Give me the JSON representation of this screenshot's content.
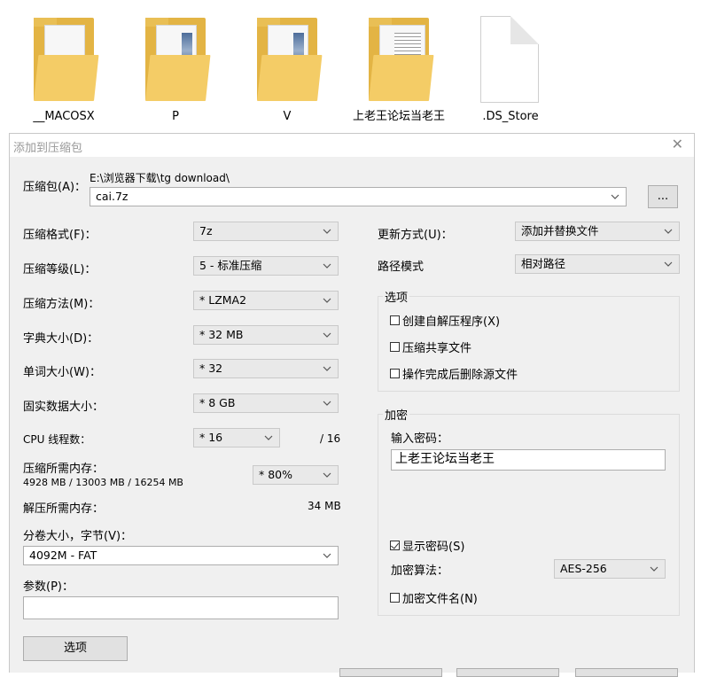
{
  "desktop": {
    "files": [
      {
        "name": "__MACOSX",
        "icon": "folder-icon"
      },
      {
        "name": "P",
        "icon": "folder-icon"
      },
      {
        "name": "V",
        "icon": "folder-icon"
      },
      {
        "name": "上老王论坛当老王",
        "icon": "folder-icon"
      },
      {
        "name": ".DS_Store",
        "icon": "file-icon"
      }
    ]
  },
  "dialog": {
    "title": "添加到压缩包",
    "close": "✕",
    "archive": {
      "label": "压缩包(A)：",
      "path": "E:\\浏览器下载\\tg download\\",
      "value": "cai.7z",
      "browse": "..."
    },
    "left": {
      "format": {
        "label": "压缩格式(F)：",
        "value": "7z"
      },
      "level": {
        "label": "压缩等级(L)：",
        "value": "5 - 标准压缩"
      },
      "method": {
        "label": "压缩方法(M)：",
        "value": "* LZMA2"
      },
      "dict": {
        "label": "字典大小(D)：",
        "value": "* 32 MB"
      },
      "word": {
        "label": "单词大小(W)：",
        "value": "* 32"
      },
      "solid": {
        "label": "固实数据大小：",
        "value": "* 8 GB"
      },
      "threads": {
        "label": "CPU 线程数：",
        "value": "* 16",
        "max": "/ 16"
      },
      "mem_compress": {
        "label": "压缩所需内存：",
        "detail": "4928 MB / 13003 MB / 16254 MB",
        "value": "* 80%"
      },
      "mem_decompress": {
        "label": "解压所需内存：",
        "value": "34 MB"
      },
      "volume": {
        "label": "分卷大小，字节(V)：",
        "value": "4092M - FAT"
      },
      "params": {
        "label": "参数(P)：",
        "value": ""
      },
      "options_button": "选项"
    },
    "right": {
      "update": {
        "label": "更新方式(U)：",
        "value": "添加并替换文件"
      },
      "path_mode": {
        "label": "路径模式",
        "value": "相对路径"
      },
      "options": {
        "title": "选项",
        "sfx": "创建自解压程序(X)",
        "shared": "压缩共享文件",
        "delete": "操作完成后删除源文件"
      },
      "encryption": {
        "title": "加密",
        "password_label": "输入密码：",
        "password": "上老王论坛当老王",
        "show_password": "显示密码(S)",
        "method_label": "加密算法：",
        "method": "AES-256",
        "encrypt_names": "加密文件名(N)"
      }
    },
    "colors": {
      "dialog_bg": "#f0f0f0",
      "combo_bg": "#e9e9e9",
      "folder": "#f4cc66"
    }
  }
}
